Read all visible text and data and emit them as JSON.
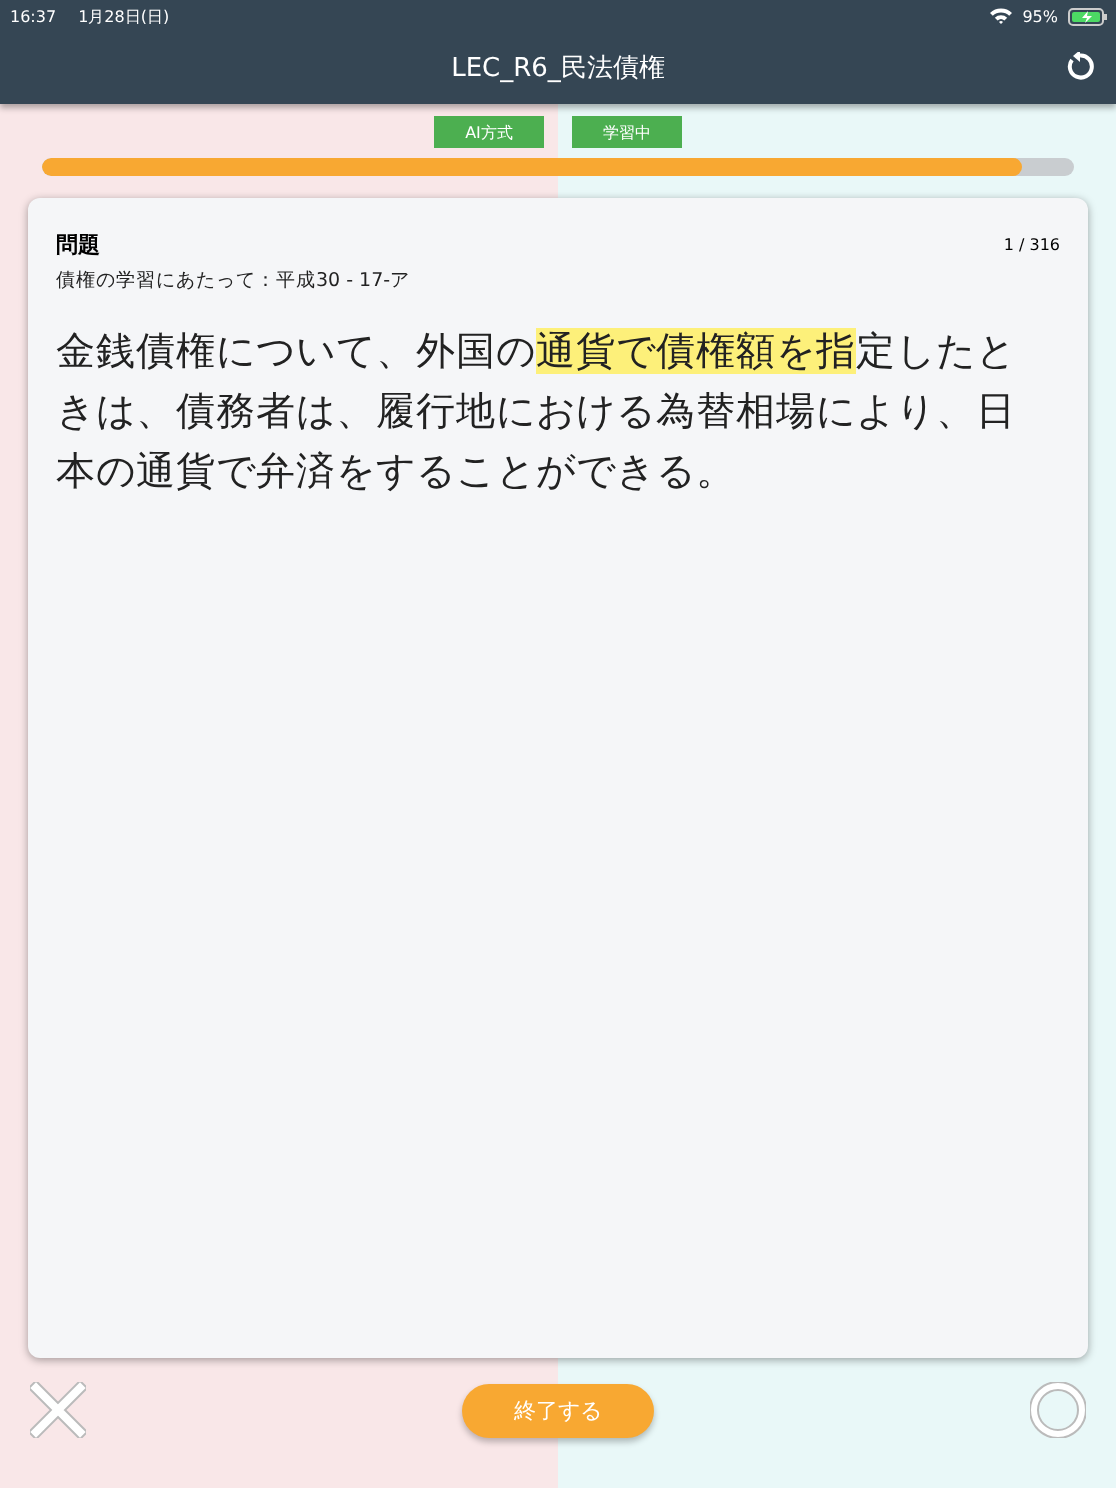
{
  "status_bar": {
    "time": "16:37",
    "date": "1月28日(日)",
    "battery": "95%"
  },
  "header": {
    "title": "LEC_R6_民法債権"
  },
  "tags": [
    "AI方式",
    "学習中"
  ],
  "progress": {
    "level": 0.95
  },
  "card": {
    "heading": "問題",
    "counter": "1 / 316",
    "source": "債権の学習にあたって：平成30 - 17-ア",
    "question": {
      "before": "金銭債権について、外国の",
      "highlight": "通貨で債権額を指",
      "after": "定したときは、債務者は、履行地における為替相場により、日本の通貨で弁済をすることができる。"
    }
  },
  "finish_button": "終了する"
}
